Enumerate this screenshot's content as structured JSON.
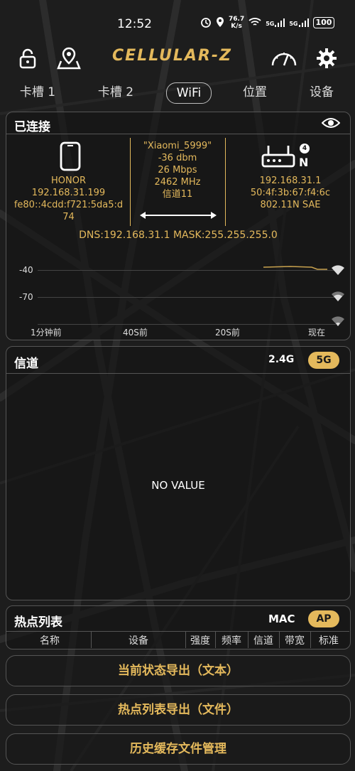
{
  "status_bar": {
    "time": "12:52",
    "net_speed_value": "76.7",
    "net_speed_unit": "K/s",
    "sim1_label": "5G",
    "sim2_label": "5G",
    "battery": "100"
  },
  "header": {
    "title": "CELLULAR-Z",
    "icons": [
      "lock-icon",
      "map-pin-icon",
      "speedometer-icon",
      "gear-icon"
    ]
  },
  "tabs": [
    {
      "label": "卡槽 1"
    },
    {
      "label": "卡槽 2"
    },
    {
      "label": "WiFi",
      "active": true
    },
    {
      "label": "位置"
    },
    {
      "label": "设备"
    }
  ],
  "connected": {
    "title": "已连接",
    "device": {
      "name": "HONOR",
      "ipv4": "192.168.31.199",
      "ipv6_line1": "fe80::4cdd:f721:5da5:d",
      "ipv6_line2": "74"
    },
    "link": {
      "ssid": "\"Xiaomi_5999\"",
      "rssi": "-36 dbm",
      "speed": "26 Mbps",
      "freq": "2462 MHz",
      "channel": "信道11"
    },
    "router": {
      "wifi_gen": "4",
      "band_letter": "N",
      "gateway": "192.168.31.1",
      "bssid": "50:4f:3b:67:f4:6c",
      "standard": "802.11N  SAE"
    },
    "dns_mask": "DNS:192.168.31.1  MASK:255.255.255.0",
    "graph": {
      "y_labels": [
        "-40",
        "-70"
      ],
      "x_labels": [
        "1分钟前",
        "40S前",
        "20S前",
        "现在"
      ]
    }
  },
  "channel_panel": {
    "title": "信道",
    "band_24": "2.4G",
    "band_5": "5G",
    "empty_text": "NO VALUE"
  },
  "hotspot_panel": {
    "title": "热点列表",
    "mac_label": "MAC",
    "ap_label": "AP",
    "columns": [
      "名称",
      "设备",
      "强度",
      "频率",
      "信道",
      "带宽",
      "标准"
    ]
  },
  "actions": {
    "export_status": "当前状态导出（文本）",
    "export_hotspots": "热点列表导出（文件）",
    "history_cache": "历史缓存文件管理"
  },
  "colors": {
    "accent": "#e4b95c",
    "background": "#1c1c1c",
    "border": "#555555"
  }
}
